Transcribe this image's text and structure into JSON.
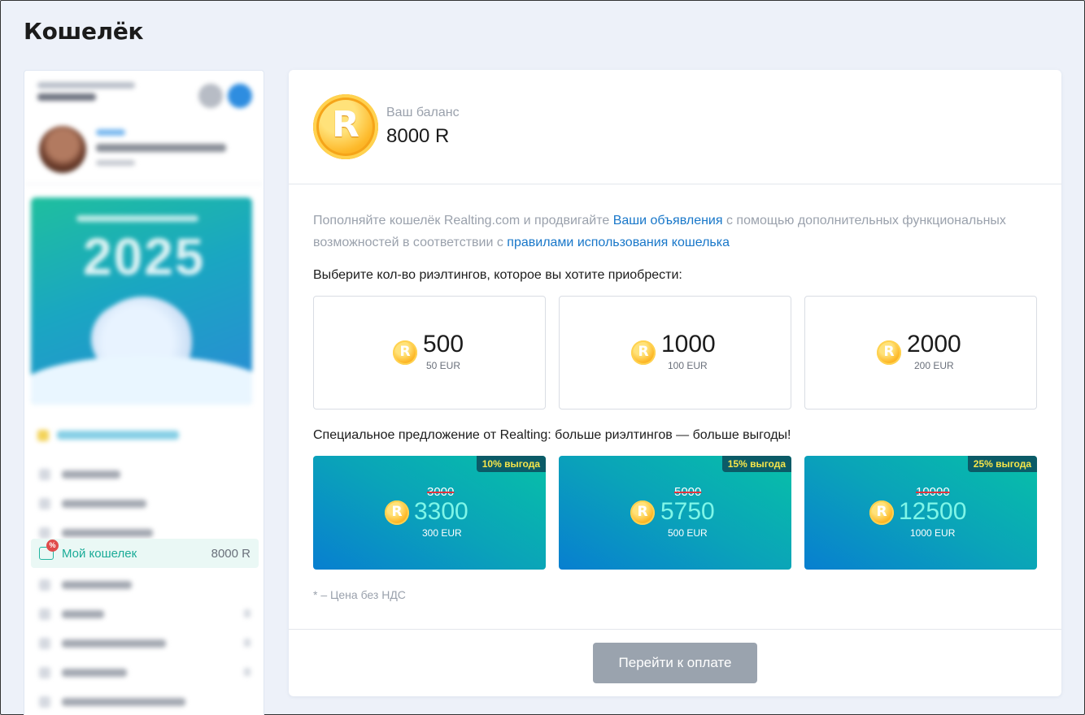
{
  "page": {
    "title": "Кошелёк"
  },
  "sidebar": {
    "wallet_item": {
      "label": "Мой кошелек",
      "value": "8000 R",
      "badge": "%"
    }
  },
  "balance": {
    "label": "Ваш баланс",
    "value": "8000 R",
    "coin_symbol": "R"
  },
  "intro": {
    "text1": "Пополняйте кошелёк Realting.com и продвигайте ",
    "link1": "Ваши объявления",
    "text2": " с помощью дополнительных функциональных возможностей в соответствии с ",
    "link2": "правилами использования кошелька"
  },
  "choose_heading": "Выберите кол-во риэлтингов, которое вы хотите приобрести:",
  "packages": [
    {
      "amount": "500",
      "price": "50 EUR"
    },
    {
      "amount": "1000",
      "price": "100 EUR"
    },
    {
      "amount": "2000",
      "price": "200 EUR"
    }
  ],
  "special_heading": "Специальное предложение от Realting: больше риэлтингов — больше выгоды!",
  "offers": [
    {
      "badge": "10% выгода",
      "old": "3000",
      "amount": "3300",
      "price": "300 EUR"
    },
    {
      "badge": "15% выгода",
      "old": "5000",
      "amount": "5750",
      "price": "500 EUR"
    },
    {
      "badge": "25% выгода",
      "old": "10000",
      "amount": "12500",
      "price": "1000 EUR"
    }
  ],
  "note": "* – Цена без НДС",
  "pay_button": "Перейти к оплате",
  "colors": {
    "accent_teal": "#1aab97",
    "link": "#1877c9",
    "offer_from": "#087fd0",
    "offer_to": "#07c0a8",
    "badge_text": "#f7e64a"
  }
}
